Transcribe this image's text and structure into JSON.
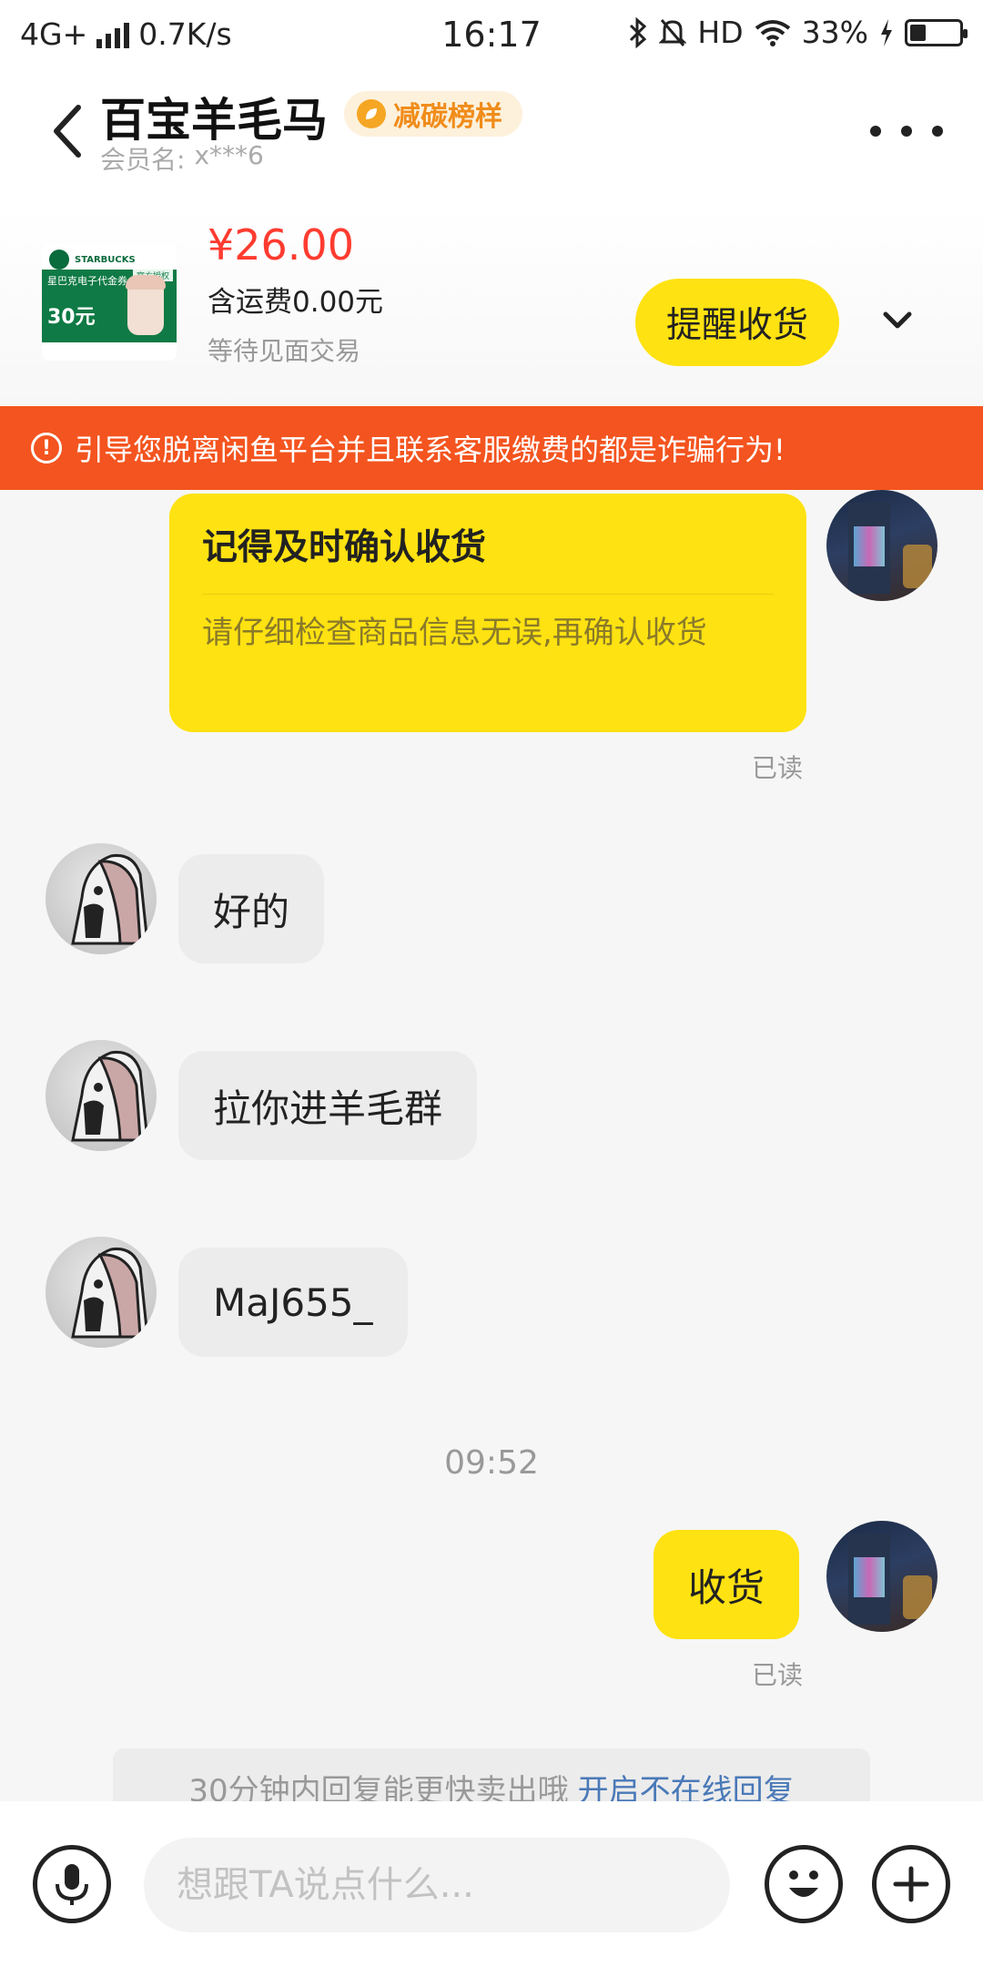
{
  "status_bar": {
    "network": "4G+",
    "speed": "0.7K/s",
    "time": "16:17",
    "hd": "HD",
    "battery": "33%",
    "battery_level": 0.33
  },
  "header": {
    "seller_name": "百宝羊毛马",
    "badge": "减碳榜样",
    "member_label": "会员名:",
    "member_id": "x***6"
  },
  "product": {
    "thumb_brand": "STARBUCKS",
    "thumb_label": "星巴克电子代金券",
    "thumb_auth": "官方授权",
    "thumb_value": "30元",
    "price": "¥26.00",
    "shipping": "含运费0.00元",
    "status": "等待见面交易",
    "remind_button": "提醒收货"
  },
  "warning": {
    "text": "引导您脱离闲鱼平台并且联系客服缴费的都是诈骗行为!"
  },
  "messages": {
    "card_title": "记得及时确认收货",
    "card_body": "请仔细检查商品信息无误,再确认收货",
    "read_1": "已读",
    "msg_1": "好的",
    "msg_2": "拉你进羊毛群",
    "msg_3": "MaJ655_",
    "time": "09:52",
    "msg_4": "收货",
    "read_2": "已读"
  },
  "hint": {
    "text": "30分钟内回复能更快卖出哦",
    "link": "开启不在线回复"
  },
  "input": {
    "placeholder": "想跟TA说点什么..."
  },
  "colors": {
    "accent_yellow": "#ffe211",
    "warning_orange": "#f4541f",
    "price_red": "#ff3b30",
    "badge_orange": "#f08c1a",
    "link_blue": "#4a79b8"
  }
}
